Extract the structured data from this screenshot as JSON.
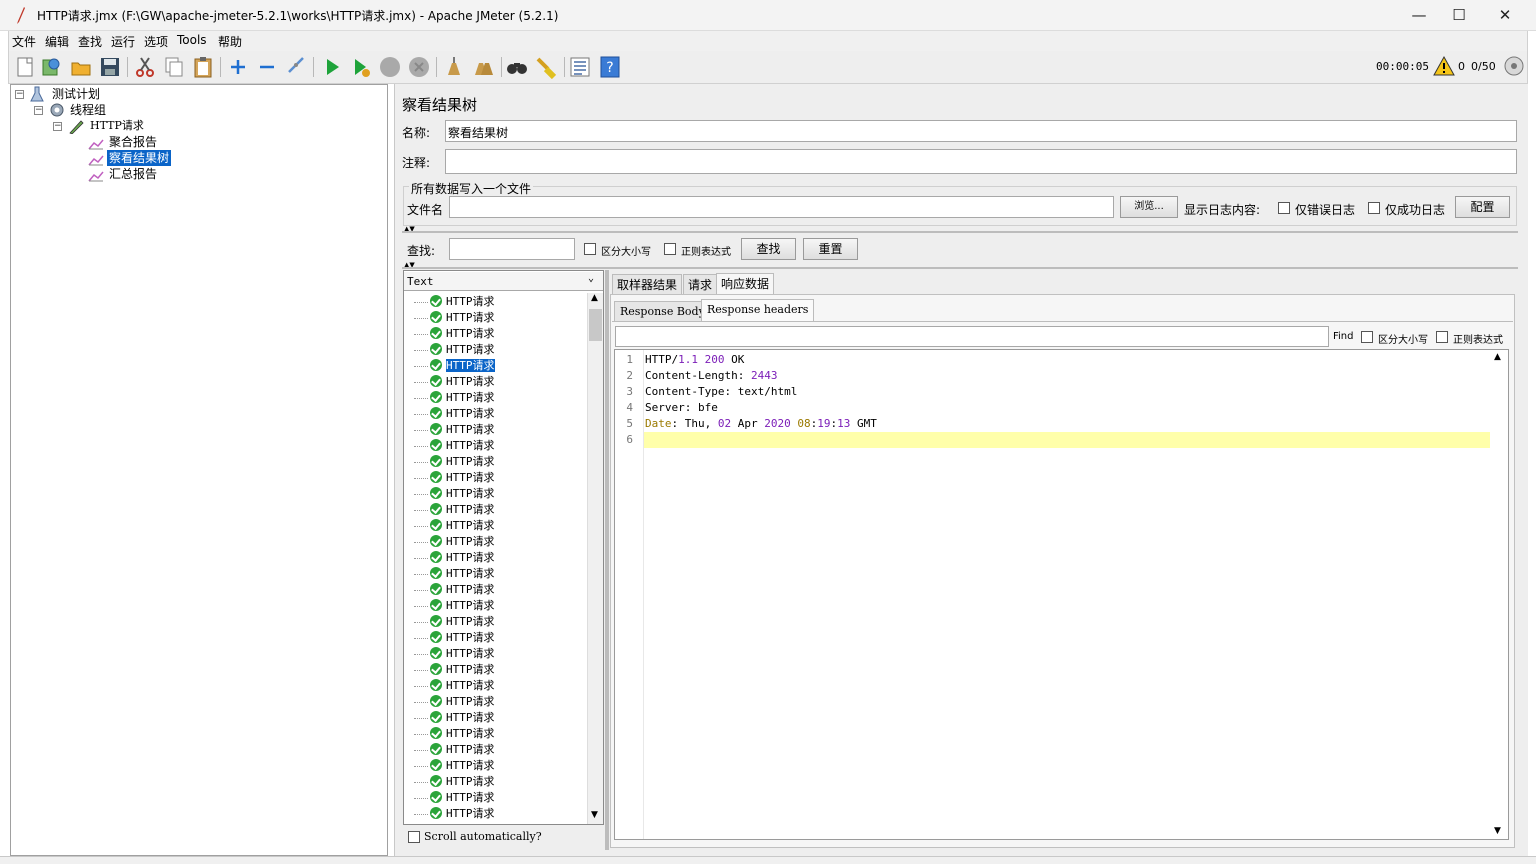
{
  "window": {
    "title": "HTTP请求.jmx (F:\\GW\\apache-jmeter-5.2.1\\works\\HTTP请求.jmx) - Apache JMeter (5.2.1)",
    "minimize_glyph": "—",
    "maximize_glyph": "☐",
    "close_glyph": "✕"
  },
  "menu": [
    "文件",
    "编辑",
    "查找",
    "运行",
    "选项",
    "Tools",
    "帮助"
  ],
  "toolbar": {
    "timer": "00:00:05",
    "warning_count": "0",
    "threads": "0/50",
    "icons": [
      "new-icon",
      "templates-icon",
      "open-icon",
      "save-icon",
      "cut-icon",
      "copy-icon",
      "paste-icon",
      "expand-icon",
      "collapse-icon",
      "toggle-icon",
      "start-icon",
      "start-no-pause-icon",
      "stop-icon",
      "shutdown-icon",
      "clear-icon",
      "clear-all-icon",
      "search-icon",
      "reset-search-icon",
      "function-helper-icon",
      "help-icon"
    ]
  },
  "tree": {
    "items": [
      {
        "label": "测试计划",
        "level": 0
      },
      {
        "label": "线程组",
        "level": 1
      },
      {
        "label": "HTTP请求",
        "level": 2
      },
      {
        "label": "聚合报告",
        "level": 3
      },
      {
        "label": "察看结果树",
        "level": 3,
        "selected": true
      },
      {
        "label": "汇总报告",
        "level": 3
      }
    ]
  },
  "panel": {
    "title": "察看结果树",
    "name_label": "名称:",
    "name_value": "察看结果树",
    "comment_label": "注释:",
    "comment_value": "",
    "file_group_title": "所有数据写入一个文件",
    "filename_label": "文件名",
    "filename_value": "",
    "browse_label": "浏览...",
    "log_display_label": "显示日志内容:",
    "errors_only_label": "仅错误日志",
    "success_only_label": "仅成功日志",
    "configure_label": "配置"
  },
  "search": {
    "label": "查找:",
    "value": "",
    "case_label": "区分大小写",
    "regex_label": "正则表达式",
    "find_button": "查找",
    "reset_button": "重置"
  },
  "results": {
    "renderer": "Text",
    "item_label": "HTTP请求",
    "count": 33,
    "selected_index": 4,
    "scroll_auto_label": "Scroll automatically?"
  },
  "tabs": {
    "main": [
      "取样器结果",
      "请求",
      "响应数据"
    ],
    "active_main": 2,
    "sub": [
      "Response Body",
      "Response headers"
    ],
    "active_sub": 1
  },
  "find_bar": {
    "value": "",
    "find_label": "Find",
    "case_label": "区分大小写",
    "regex_label": "正则表达式"
  },
  "response_headers": {
    "line_numbers": [
      "1",
      "2",
      "3",
      "4",
      "5",
      "6"
    ],
    "l1_proto": "HTTP/",
    "l1_ver": "1.1",
    "l1_sp": " ",
    "l1_code": "200",
    "l1_msg": " OK",
    "l2_key": "Content-Length: ",
    "l2_val": "2443",
    "l3": "Content-Type: text/html",
    "l4": "Server: bfe",
    "l5_key": "Date",
    "l5_a": ": Thu, ",
    "l5_day": "02",
    "l5_b": " Apr ",
    "l5_year": "2020",
    "l5_sp": " ",
    "l5_hh": "08",
    "l5_c": ":",
    "l5_mm": "19",
    "l5_d": ":",
    "l5_ss": "13",
    "l5_e": " GMT"
  },
  "colors": {
    "selection": "#0a64c8",
    "ok_icon": "#2ba43a",
    "current_line": "#ffffaa",
    "number_token": "#7c1fb8",
    "keyword_token": "#9b7a00"
  }
}
